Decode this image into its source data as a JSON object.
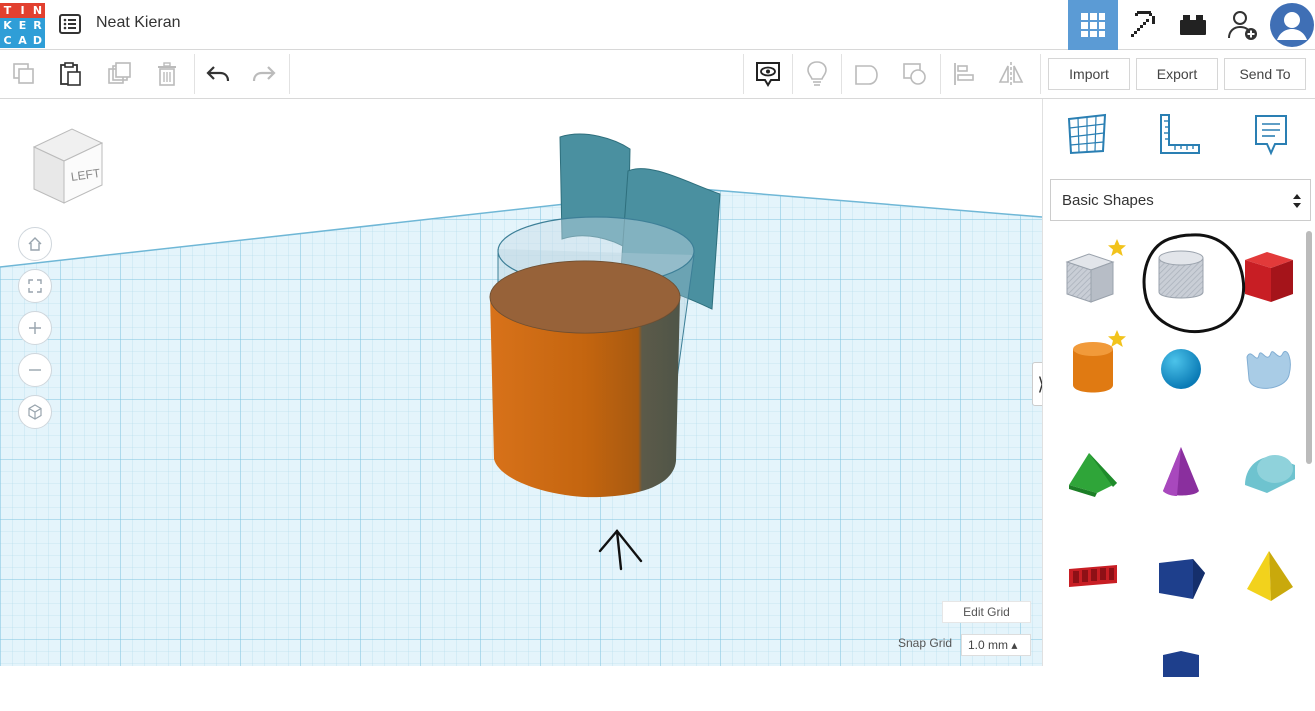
{
  "logo": {
    "letters": [
      "T",
      "I",
      "N",
      "K",
      "E",
      "R",
      "C",
      "A",
      "D"
    ],
    "colors": [
      "#e2402f",
      "#e2402f",
      "#e2402f",
      "#2f9ed7",
      "#2f9ed7",
      "#2f9ed7",
      "#2f9ed7",
      "#2f9ed7",
      "#2f9ed7"
    ]
  },
  "header": {
    "title": "Neat Kieran",
    "active_view": "3d-design"
  },
  "toolbar": {
    "import_label": "Import",
    "export_label": "Export",
    "send_to_label": "Send To"
  },
  "viewcube": {
    "face_label": "LEFT"
  },
  "grid": {
    "edit_grid_label": "Edit Grid",
    "snap_grid_label": "Snap Grid",
    "snap_grid_value": "1.0 mm ▴"
  },
  "panel": {
    "library_label": "Basic Shapes",
    "collapse_glyph": "⟩"
  },
  "colors": {
    "accent": "#5b9bd5",
    "grid_bg": "#e8f5fb",
    "orange_cylinder": "#e07a1a",
    "teal_shape": "#3d8a9a"
  }
}
